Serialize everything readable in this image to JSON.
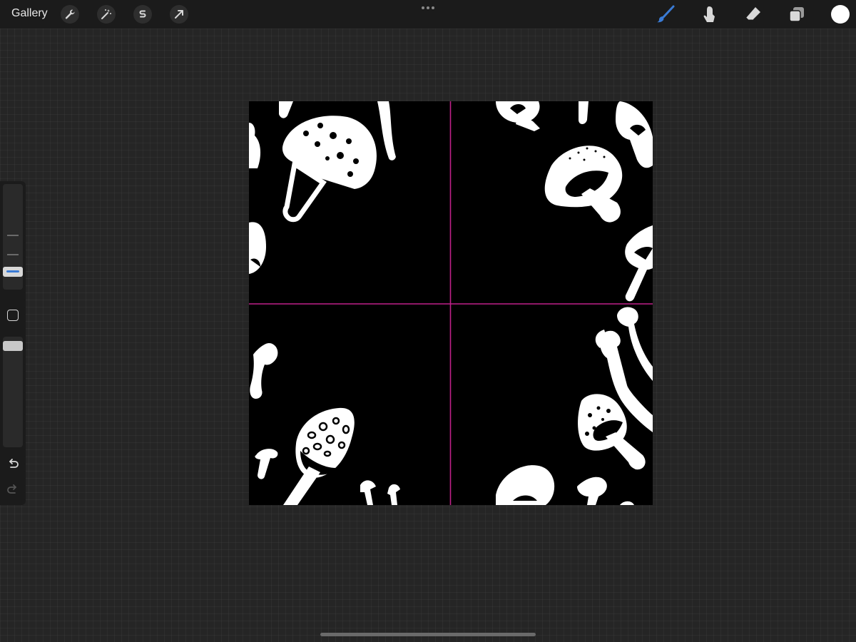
{
  "toolbar": {
    "gallery_label": "Gallery",
    "left_tools": [
      {
        "name": "actions",
        "icon": "wrench-icon"
      },
      {
        "name": "adjustments",
        "icon": "magic-wand-icon"
      },
      {
        "name": "selection",
        "icon": "selection-s-icon"
      },
      {
        "name": "transform",
        "icon": "arrow-cursor-icon"
      }
    ],
    "center_menu_icon": "more-dots-icon",
    "right_tools": [
      {
        "name": "brush",
        "icon": "brush-icon",
        "active": true
      },
      {
        "name": "smudge",
        "icon": "smudge-finger-icon",
        "active": false
      },
      {
        "name": "eraser",
        "icon": "eraser-icon",
        "active": false
      },
      {
        "name": "layers",
        "icon": "layers-icon",
        "active": false
      }
    ],
    "current_color": "#ffffff",
    "active_color": "#3a7bd5"
  },
  "sidebar": {
    "brush_size": 0.18,
    "opacity": 1.0,
    "modify_button_icon": "square-modify-icon",
    "undo_icon": "undo-arrow-icon",
    "redo_icon": "redo-arrow-icon"
  },
  "canvas": {
    "background": "#000000",
    "guide_color": "#c0208a",
    "artwork": "mushroom-pattern"
  }
}
